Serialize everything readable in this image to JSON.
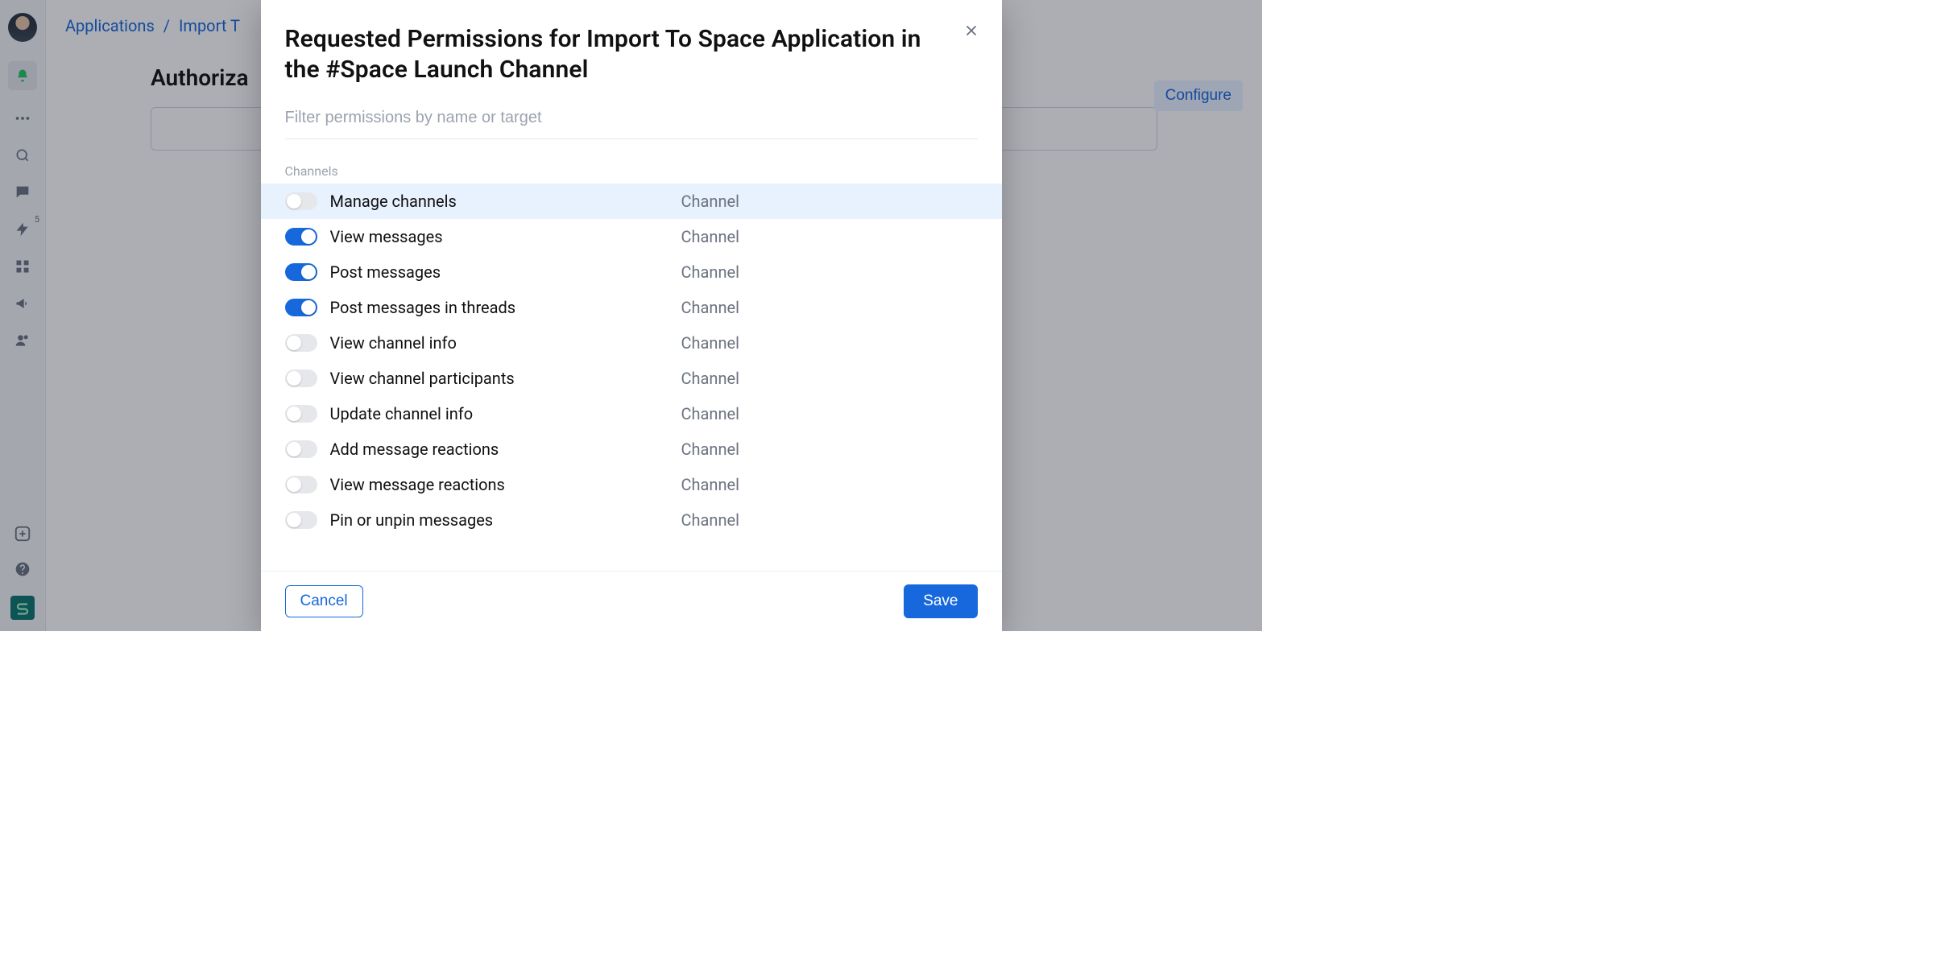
{
  "breadcrumb": {
    "root": "Applications",
    "current": "Import To Space",
    "current_visible": "Import T"
  },
  "page": {
    "section_heading_visible": "Authoriza",
    "configure_label": "Configure"
  },
  "sidebar": {
    "badge_5": "5"
  },
  "modal": {
    "title": "Requested Permissions for Import To Space Application in the #Space Launch Channel",
    "filter_placeholder": "Filter permissions by name or target",
    "group_label": "Channels",
    "permissions": [
      {
        "label": "Manage channels",
        "target": "Channel",
        "on": false,
        "highlight": true
      },
      {
        "label": "View messages",
        "target": "Channel",
        "on": true
      },
      {
        "label": "Post messages",
        "target": "Channel",
        "on": true
      },
      {
        "label": "Post messages in threads",
        "target": "Channel",
        "on": true
      },
      {
        "label": "View channel info",
        "target": "Channel",
        "on": false
      },
      {
        "label": "View channel participants",
        "target": "Channel",
        "on": false
      },
      {
        "label": "Update channel info",
        "target": "Channel",
        "on": false
      },
      {
        "label": "Add message reactions",
        "target": "Channel",
        "on": false
      },
      {
        "label": "View message reactions",
        "target": "Channel",
        "on": false
      },
      {
        "label": "Pin or unpin messages",
        "target": "Channel",
        "on": false
      }
    ],
    "cancel_label": "Cancel",
    "save_label": "Save"
  }
}
